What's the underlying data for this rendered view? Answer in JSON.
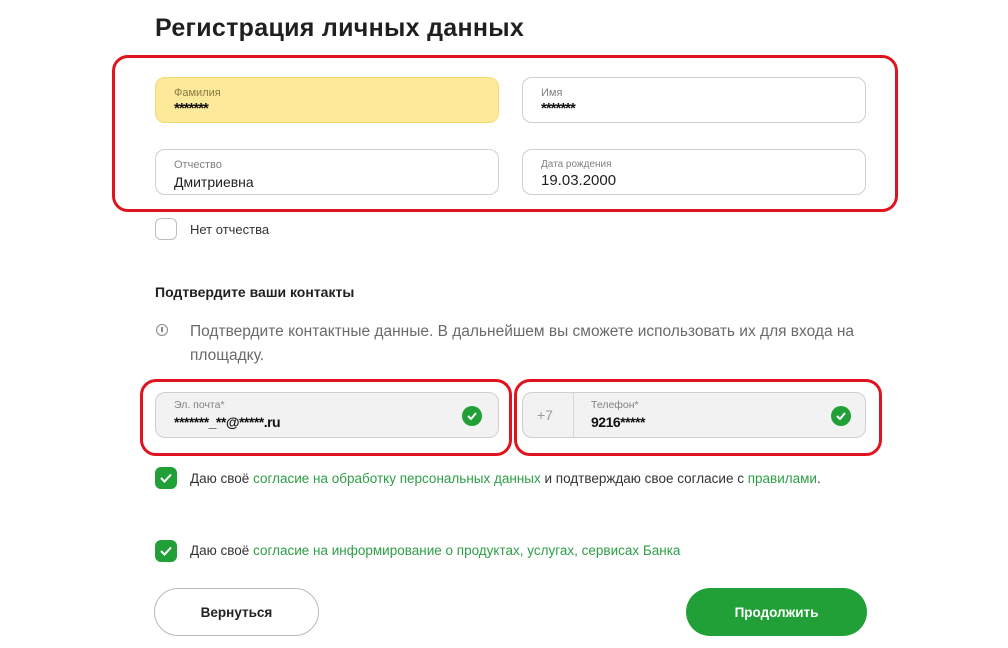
{
  "title": "Регистрация личных данных",
  "personal": {
    "surname": {
      "label": "Фамилия",
      "value": "*******"
    },
    "name": {
      "label": "Имя",
      "value": "*******"
    },
    "patronymic": {
      "label": "Отчество",
      "value": "Дмитриевна"
    },
    "birthdate": {
      "label": "Дата рождения",
      "value": "19.03.2000"
    },
    "no_patronymic_label": "Нет отчества"
  },
  "contacts": {
    "heading": "Подтвердите ваши контакты",
    "info": "Подтвердите контактные данные. В дальнейшем вы сможете использовать их для входа на площадку.",
    "email": {
      "label": "Эл. почта*",
      "value": "*******_**@*****.ru"
    },
    "phone": {
      "label": "Телефон*",
      "prefix": "+7",
      "value": "9216*****"
    }
  },
  "consents": {
    "c1_prefix": "Даю своё ",
    "c1_link1": "согласие на обработку персональных данных",
    "c1_middle": " и подтверждаю свое согласие с ",
    "c1_link2": "правилами",
    "c1_suffix": ".",
    "c2_prefix": "Даю своё ",
    "c2_link": "согласие на информирование о продуктах, услугах, сервисах Банка"
  },
  "buttons": {
    "back": "Вернуться",
    "next": "Продолжить"
  },
  "colors": {
    "accent": "#21a038",
    "highlight": "#e0141f",
    "autofill": "#fde99a"
  }
}
